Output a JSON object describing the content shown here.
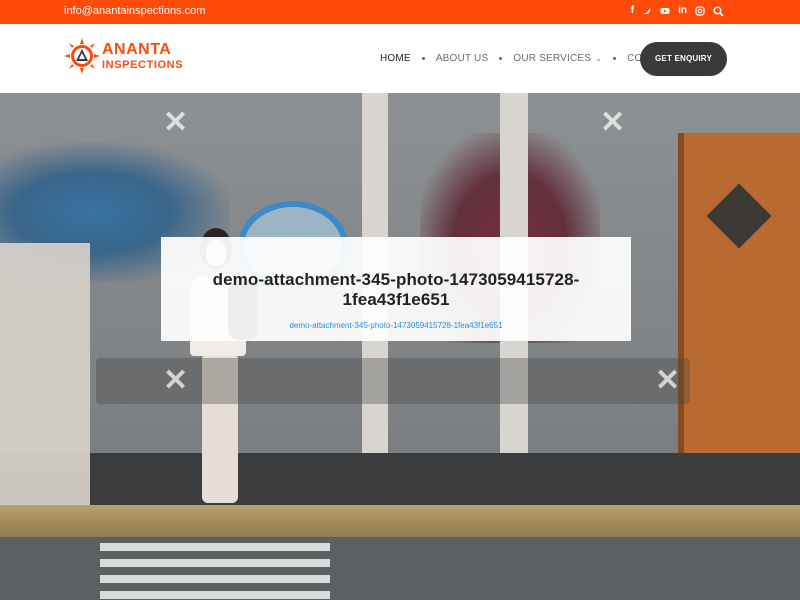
{
  "topbar": {
    "email": "info@anantainspections.com",
    "social_icons": [
      "facebook-icon",
      "twitter-icon",
      "youtube-icon",
      "linkedin-icon",
      "instagram-icon",
      "search-icon"
    ]
  },
  "header": {
    "logo": {
      "line1": "ANANTA",
      "line2": "INSPECTIONS"
    },
    "nav": [
      {
        "label": "HOME"
      },
      {
        "label": "ABOUT US"
      },
      {
        "label": "OUR SERVICES"
      },
      {
        "label": "CONTACT US"
      }
    ],
    "cta": "GET ENQUIRY"
  },
  "hero": {
    "title": "demo-attachment-345-photo-1473059415728-1fea43f1e651",
    "link": "demo-attachment-345-photo-1473059415728-1fea43f1e651"
  },
  "colors": {
    "brand": "#ff4a0a",
    "cta": "#3a3a3a",
    "link": "#2a8fd4"
  }
}
